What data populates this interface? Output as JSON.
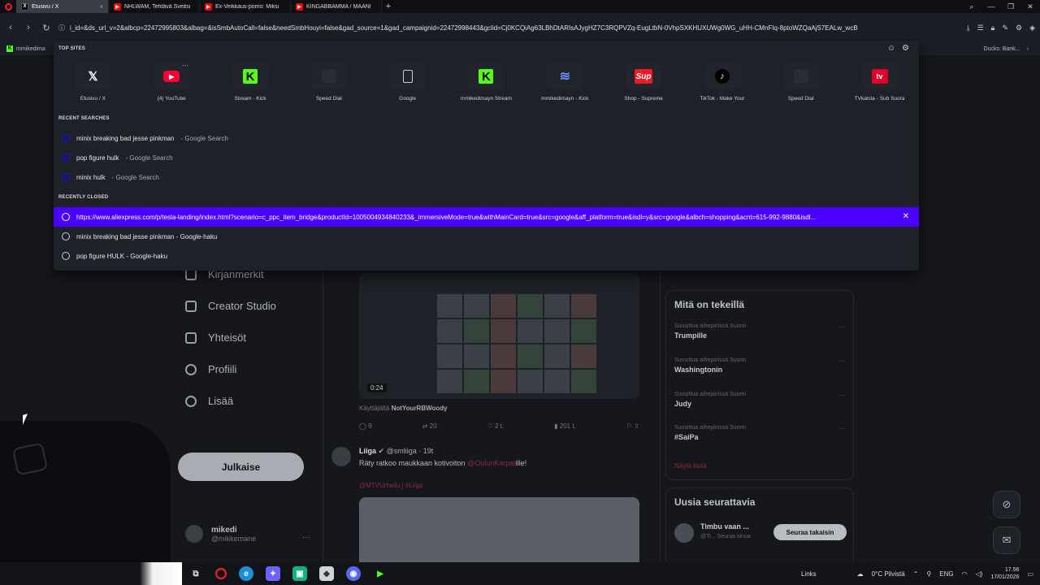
{
  "tabs": [
    {
      "title": "Etusivu / X",
      "icon": "x",
      "active": true
    },
    {
      "title": "NHLWAM, Tehtävä Sveitsi",
      "icon": "youtube"
    },
    {
      "title": "Ex-Veikkaus-pomo: Miksi",
      "icon": "youtube"
    },
    {
      "title": "KINGABBAMMA / MAANI",
      "icon": "youtube"
    }
  ],
  "address": {
    "url": "i_id=&ds_url_v=2&albcp=22472995803&albag=&isSmbAutoCall=false&needSmbHouyi=false&gad_source=1&gad_campaignid=22472998443&gclid=Cj0KCQiAg63LBhDtARIsAJygHZ7C3RQPVZq-EugLtbN-0VhpSXKHUXUWg0WG_uHH-CMnFIq-8ptoWZQaAjS7EALw_wcB"
  },
  "bookmarks": {
    "left": "mmikedima",
    "right": "Ducks: Bank..."
  },
  "speed_dial": {
    "top_sites_label": "TOP SITES",
    "sites": [
      {
        "label": "Etusivu / X",
        "icon": "x-icon",
        "glyph": "𝕏"
      },
      {
        "label": "(4) YouTube",
        "icon": "youtube-icon",
        "glyph": "▶"
      },
      {
        "label": "Stream - Kick",
        "icon": "kick-icon",
        "glyph": "K"
      },
      {
        "label": "Speed Dial",
        "icon": "blank-icon",
        "glyph": ""
      },
      {
        "label": "Google",
        "icon": "document-icon",
        "glyph": ""
      },
      {
        "label": "mmikedimayn Stream",
        "icon": "kick-icon",
        "glyph": "K"
      },
      {
        "label": "mmikedimayn - Kick",
        "icon": "wave-icon",
        "glyph": "≋"
      },
      {
        "label": "Shop - Supreme",
        "icon": "supreme-icon",
        "glyph": "Sup"
      },
      {
        "label": "TikTok - Make Your",
        "icon": "tiktok-icon",
        "glyph": "♪"
      },
      {
        "label": "Speed Dial",
        "icon": "blank-icon",
        "glyph": ""
      },
      {
        "label": "TVkaista - Sub Suora",
        "icon": "tv-icon",
        "glyph": "tv"
      }
    ],
    "recent_searches_label": "RECENT SEARCHES",
    "recent_searches": [
      {
        "query": "minix breaking bad jesse pinkman",
        "source": "- Google Search"
      },
      {
        "query": "pop figure hulk",
        "source": "- Google Search"
      },
      {
        "query": "minix hulk",
        "source": "- Google Search"
      }
    ],
    "recently_closed_label": "RECENTLY CLOSED",
    "recently_closed": [
      {
        "text": "https://www.aliexpress.com/p/tesla-landing/index.html?scenario=c_ppc_item_bridge&productId=1005004934840233&_immersiveMode=true&withMainCard=true&src=google&aff_platform=true&isdl=y&src=google&albch=shopping&acnt=615-992-9880&isdl..."
      },
      {
        "text": "minix breaking bad jesse pinkman - Google-haku"
      },
      {
        "text": "pop figure HULK - Google-haku"
      }
    ]
  },
  "x_page": {
    "nav": [
      {
        "label": "Kirjanmerkit",
        "icon": "bookmark-icon"
      },
      {
        "label": "Creator Studio",
        "icon": "creator-studio-icon"
      },
      {
        "label": "Yhteisöt",
        "icon": "communities-icon"
      },
      {
        "label": "Profiili",
        "icon": "profile-icon"
      },
      {
        "label": "Lisää",
        "icon": "more-icon"
      }
    ],
    "post_button": "Julkaise",
    "account": {
      "name": "mikedi",
      "handle": "@mikkemane"
    },
    "feed": {
      "video_time": "0:24",
      "credit_prefix": "Käyttäjältä",
      "credit_user": "NotYourRBWoody",
      "actions": [
        "9",
        "20",
        "2 t.",
        "201 t."
      ],
      "post2": {
        "name": "Liiga",
        "handle": "@smliiga · 19t",
        "text_prefix": "Räty ratkoo maukkaan kotivoiton",
        "mention": "@OulunKarpat",
        "text_suffix": "ille!",
        "tags": "@MTVUrheilu | #Liiga"
      }
    },
    "trends": {
      "title": "Mitä on tekeillä",
      "items": [
        {
          "sub": "Suosittua aihepiirissä Suomi",
          "name": "Trumpille"
        },
        {
          "sub": "Suosittua aihepiirissä Suomi",
          "name": "Washingtonin"
        },
        {
          "sub": "Suosittua aihepiirissä Suomi",
          "name": "Judy"
        },
        {
          "sub": "Suosittua aihepiirissä Suomi",
          "name": "#SaiPa"
        }
      ],
      "show_more": "Näytä lisää"
    },
    "who_to_follow": {
      "title": "Uusia seurattavia",
      "name": "Timbu vaan ...",
      "handle": "@Ti...  Seuraa sinua",
      "button": "Seuraa takaisin"
    }
  },
  "taskbar": {
    "links": "Links",
    "weather": "0°C  Pilvistä",
    "lang": "ENG",
    "time": "17.56",
    "date": "17/01/2026"
  }
}
